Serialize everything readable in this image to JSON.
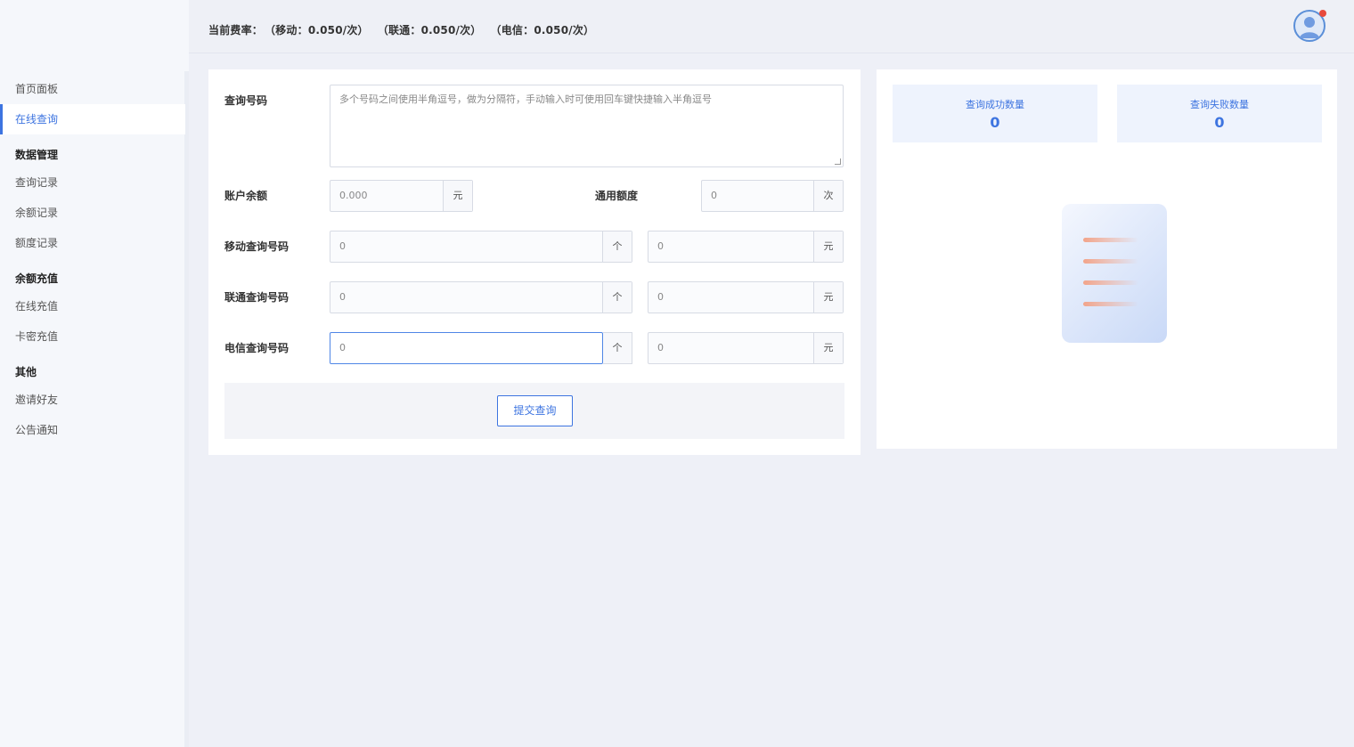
{
  "sidebar": {
    "items": [
      {
        "label": "首页面板"
      },
      {
        "label": "在线查询"
      }
    ],
    "groups": [
      {
        "title": "数据管理",
        "items": [
          {
            "label": "查询记录"
          },
          {
            "label": "余额记录"
          },
          {
            "label": "额度记录"
          }
        ]
      },
      {
        "title": "余额充值",
        "items": [
          {
            "label": "在线充值"
          },
          {
            "label": "卡密充值"
          }
        ]
      },
      {
        "title": "其他",
        "items": [
          {
            "label": "邀请好友"
          },
          {
            "label": "公告通知"
          }
        ]
      }
    ]
  },
  "header": {
    "rate_label": "当前费率：",
    "rates": [
      {
        "text": "（移动：0.050/次）"
      },
      {
        "text": "（联通：0.050/次）"
      },
      {
        "text": "（电信：0.050/次）"
      }
    ]
  },
  "form": {
    "query_numbers": {
      "label": "查询号码",
      "placeholder": "多个号码之间使用半角逗号，做为分隔符，手动输入时可使用回车键快捷输入半角逗号"
    },
    "balance": {
      "label": "账户余额",
      "value": "0.000",
      "unit": "元"
    },
    "quota": {
      "label": "通用额度",
      "value": "0",
      "unit": "次"
    },
    "rows": [
      {
        "label": "移动查询号码",
        "count": "0",
        "count_unit": "个",
        "cost": "0",
        "cost_unit": "元"
      },
      {
        "label": "联通查询号码",
        "count": "0",
        "count_unit": "个",
        "cost": "0",
        "cost_unit": "元"
      },
      {
        "label": "电信查询号码",
        "count": "0",
        "count_unit": "个",
        "cost": "0",
        "cost_unit": "元"
      }
    ],
    "submit_label": "提交查询"
  },
  "stats": {
    "success": {
      "label": "查询成功数量",
      "value": "0"
    },
    "fail": {
      "label": "查询失败数量",
      "value": "0"
    }
  },
  "colors": {
    "accent": "#3d74e0",
    "background": "#eef0f7",
    "notification_dot": "#e84a3c"
  },
  "icons": {
    "avatar": "user-avatar-icon",
    "illustration": "document-list-icon"
  }
}
